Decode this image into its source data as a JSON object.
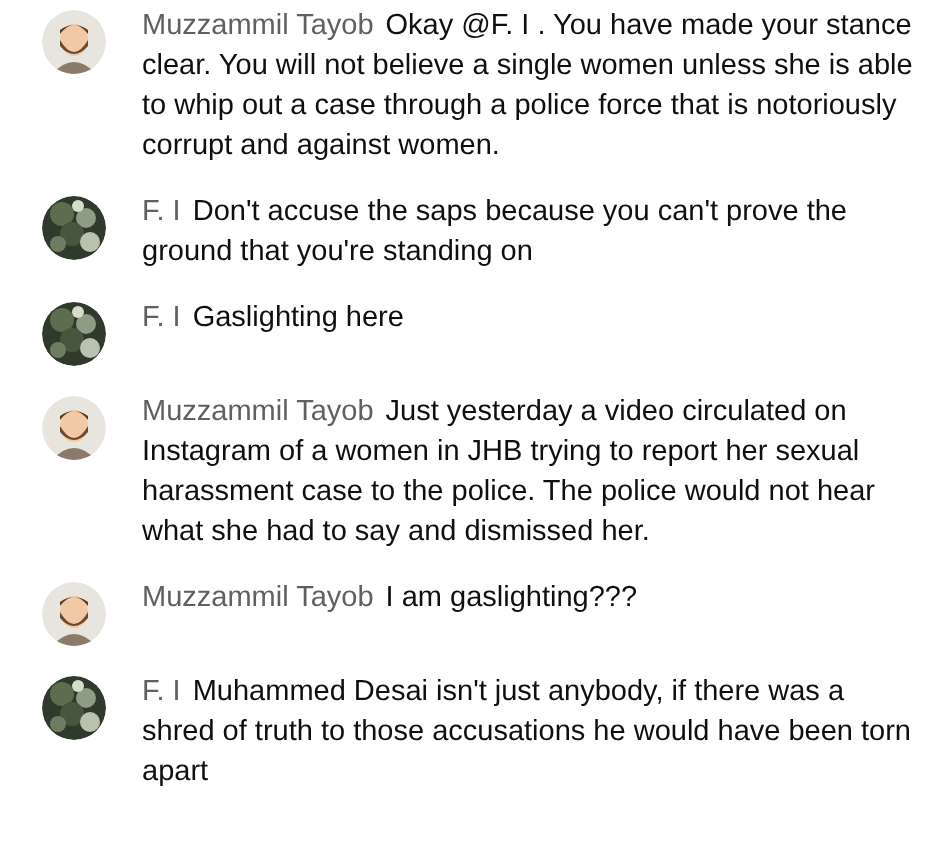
{
  "comments": [
    {
      "author": "Muzzammil Tayob",
      "kind": "cartoon",
      "text": "Okay @F. I . You have made your stance clear. You will not believe a single women unless she is able to whip out a case through a police force that is notoriously corrupt and against women."
    },
    {
      "author": "F. I",
      "text": "Don't accuse the saps because you can't prove the ground that you're standing on"
    },
    {
      "author": "F. I",
      "text": "Gaslighting here"
    },
    {
      "author": "Muzzammil Tayob",
      "kind": "cartoon",
      "text": "Just yesterday a video circulated on Instagram of a women in JHB trying to report her sexual harassment case to the police. The police would not hear what she had to say and dismissed her."
    },
    {
      "author": "Muzzammil Tayob",
      "kind": "cartoon",
      "text": "I am gaslighting???"
    },
    {
      "author": "F. I",
      "text": "Muhammed Desai isn't just anybody, if there was a shred of truth to those accusations he would have been torn apart"
    }
  ]
}
